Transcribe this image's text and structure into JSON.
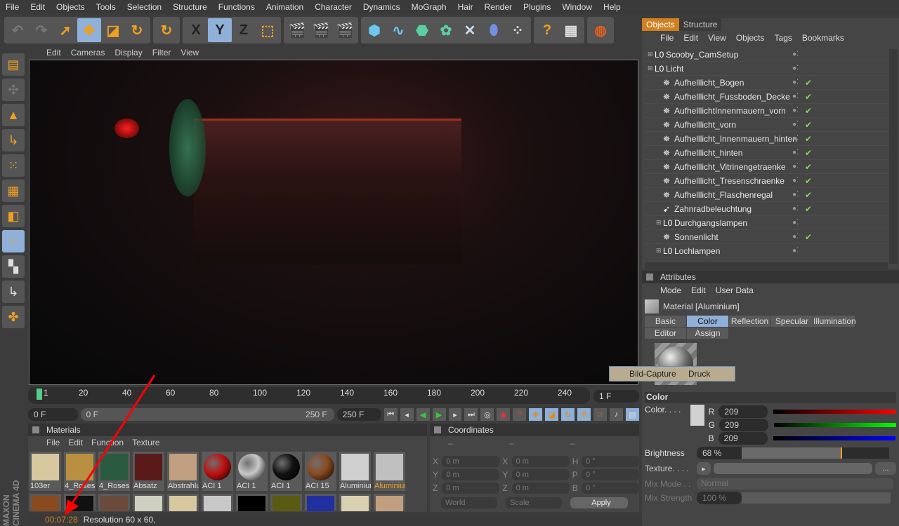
{
  "menu": [
    "File",
    "Edit",
    "Objects",
    "Tools",
    "Selection",
    "Structure",
    "Functions",
    "Animation",
    "Character",
    "Dynamics",
    "MoGraph",
    "Hair",
    "Render",
    "Plugins",
    "Window",
    "Help"
  ],
  "toolbar": {
    "axis_x": "X",
    "axis_y": "Y",
    "axis_z": "Z"
  },
  "viewport": {
    "menu": [
      "Edit",
      "Cameras",
      "Display",
      "Filter",
      "View"
    ]
  },
  "timeline": {
    "ticks": [
      "1",
      "20",
      "40",
      "60",
      "80",
      "100",
      "120",
      "140",
      "160",
      "180",
      "200",
      "220",
      "240"
    ],
    "current_frame": "1 F",
    "start": "0 F",
    "range_start": "0 F",
    "range_end": "250 F",
    "end": "250 F"
  },
  "materials": {
    "title": "Materials",
    "menu": [
      "File",
      "Edit",
      "Function",
      "Texture"
    ],
    "items": [
      {
        "name": "103er",
        "color": "#d8c8a0"
      },
      {
        "name": "4_Roses",
        "color": "#b89040"
      },
      {
        "name": "4_Roses",
        "color": "#2a5a40"
      },
      {
        "name": "Absatz",
        "color": "#5a1a1a"
      },
      {
        "name": "Abstrahlu",
        "color": "#c0a080"
      },
      {
        "name": "ACI 1",
        "color": "#c01010"
      },
      {
        "name": "ACI 1",
        "color": "#c8c8c8"
      },
      {
        "name": "ACI 1",
        "color": "#111111"
      },
      {
        "name": "ACI 15",
        "color": "#8a4a20"
      },
      {
        "name": "Aluminiur",
        "color": "#d0d0d0"
      },
      {
        "name": "Aluminiur",
        "color": "#c0c0c0",
        "selected": true
      }
    ],
    "row2_colors": [
      "#8a4a20",
      "#111111",
      "#6a4a3a",
      "#d0d0c0",
      "#d8c8a0",
      "#c8c8c8",
      "#000000",
      "#5a5a10",
      "#2030a0",
      "#d8d0b0",
      "#c0a080"
    ]
  },
  "coordinates": {
    "title": "Coordinates",
    "headers": [
      "–",
      "–",
      "–"
    ],
    "rows": [
      {
        "a": "X",
        "av": "0 m",
        "b": "X",
        "bv": "0 m",
        "c": "H",
        "cv": "0 °"
      },
      {
        "a": "Y",
        "av": "0 m",
        "b": "Y",
        "bv": "0 m",
        "c": "P",
        "cv": "0 °"
      },
      {
        "a": "Z",
        "av": "0 m",
        "b": "Z",
        "bv": "0 m",
        "c": "B",
        "cv": "0 °"
      }
    ],
    "mode1": "World",
    "mode2": "Scale",
    "apply": "Apply"
  },
  "status": {
    "time": "00:07:28",
    "text": "Resolution 60 x 60,"
  },
  "logo": "MAXON CINEMA 4D",
  "objects": {
    "tabs": [
      "Objects",
      "Structure"
    ],
    "menu": [
      "File",
      "Edit",
      "View",
      "Objects",
      "Tags",
      "Bookmarks"
    ],
    "items": [
      {
        "name": "Scooby_CamSetup",
        "type": "null",
        "indent": 0,
        "check": false
      },
      {
        "name": "Licht",
        "type": "null",
        "indent": 0,
        "check": false
      },
      {
        "name": "Aufhelllicht_Bogen",
        "type": "light",
        "indent": 1,
        "check": true
      },
      {
        "name": "Aufhelllicht_Fussboden_Decke",
        "type": "light",
        "indent": 1,
        "check": true
      },
      {
        "name": "AufhelllichtInnenmauern_vorn",
        "type": "light",
        "indent": 1,
        "check": true
      },
      {
        "name": "Aufhelllicht_vorn",
        "type": "light",
        "indent": 1,
        "check": true
      },
      {
        "name": "Aufhelllicht_Innenmauern_hinten",
        "type": "light",
        "indent": 1,
        "check": true
      },
      {
        "name": "Aufhelllicht_hinten",
        "type": "light",
        "indent": 1,
        "check": true
      },
      {
        "name": "Aufhelllicht_Vitrinengetraenke",
        "type": "light",
        "indent": 1,
        "check": true
      },
      {
        "name": "Aufhelllicht_Tresenschraenke",
        "type": "light",
        "indent": 1,
        "check": true
      },
      {
        "name": "Aufhelllicht_Flaschenregal",
        "type": "light",
        "indent": 1,
        "check": true
      },
      {
        "name": "Zahnradbeleuchtung",
        "type": "spot",
        "indent": 1,
        "check": true
      },
      {
        "name": "Durchgangslampen",
        "type": "null",
        "indent": 1,
        "check": false
      },
      {
        "name": "Sonnenlicht",
        "type": "light",
        "indent": 1,
        "check": true
      },
      {
        "name": "Lochlampen",
        "type": "null",
        "indent": 1,
        "check": false
      }
    ]
  },
  "attributes": {
    "title": "Attributes",
    "menu": [
      "Mode",
      "Edit",
      "User Data"
    ],
    "material_title": "Material [Aluminium]",
    "tabs": [
      "Basic",
      "Color",
      "Reflection",
      "Specular",
      "Illumination",
      "Editor",
      "Assign"
    ],
    "active_tab": "Color",
    "section": "Color",
    "color_label": "Color. . . .",
    "r_label": "R",
    "g_label": "G",
    "b_label": "B",
    "r": "209",
    "g": "209",
    "b": "209",
    "brightness_label": "Brightness",
    "brightness": "68 %",
    "brightness_value": 68,
    "texture_label": "Texture. . . .",
    "texture_btn": "...",
    "mix_mode_label": "Mix Mode . .",
    "mix_mode": "Normal",
    "mix_strength_label": "Mix Strength",
    "mix_strength": "100 %"
  },
  "popup": {
    "capture": "Bild-Capture",
    "print": "Druck"
  },
  "colors": {
    "accent": "#d08020",
    "selected_tab": "#8fb0d8",
    "check": "#7fdc5a"
  }
}
